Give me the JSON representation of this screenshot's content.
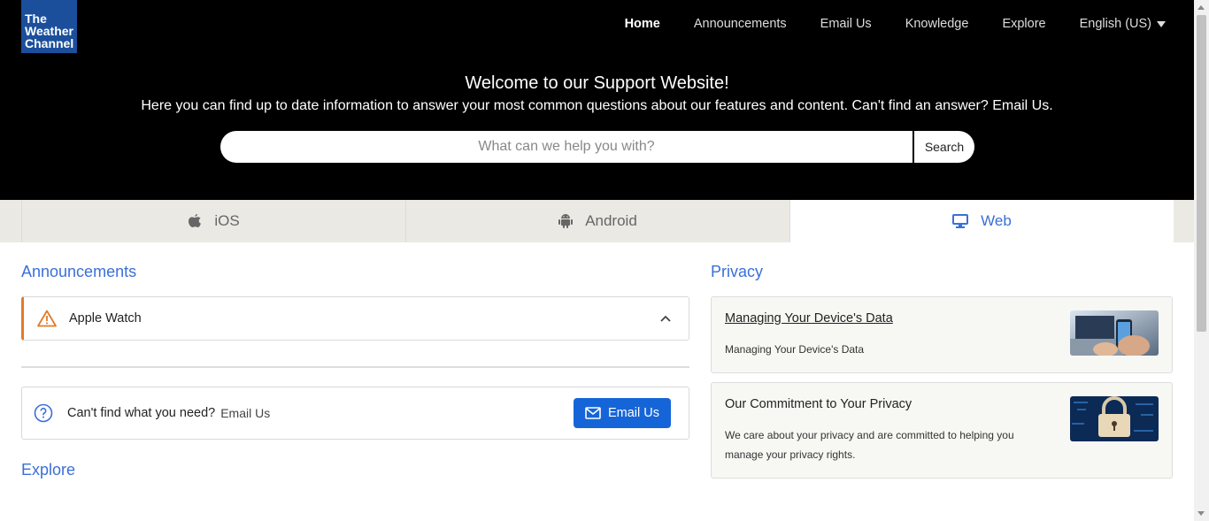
{
  "logo": {
    "line1": "The",
    "line2": "Weather",
    "line3": "Channel"
  },
  "nav": {
    "home": "Home",
    "announcements": "Announcements",
    "email": "Email Us",
    "knowledge": "Knowledge",
    "explore": "Explore",
    "language": "English (US)"
  },
  "hero": {
    "title": "Welcome to our Support Website!",
    "subtitle": "Here you can find up to date information to answer your most common questions about our features and content. Can't find an answer? Email Us.",
    "search_placeholder": "What can we help you with?",
    "search_button": "Search"
  },
  "tabs": [
    {
      "label": "iOS",
      "icon": "apple-icon"
    },
    {
      "label": "Android",
      "icon": "android-icon"
    },
    {
      "label": "Web",
      "icon": "monitor-icon",
      "active": true
    }
  ],
  "announcements": {
    "title": "Announcements",
    "items": [
      {
        "label": "Apple Watch",
        "icon": "warning-icon"
      }
    ]
  },
  "help": {
    "question": "Can't find what you need?",
    "link": "Email Us",
    "button": "Email Us"
  },
  "explore": {
    "title": "Explore"
  },
  "privacy": {
    "title": "Privacy",
    "cards": [
      {
        "title": "Managing Your Device's Data",
        "description": "Managing Your Device's Data"
      },
      {
        "title": "Our Commitment to Your Privacy",
        "description": "We care about your privacy and are committed to helping you manage your privacy rights."
      }
    ]
  },
  "colors": {
    "accent": "#3a6fd8",
    "button": "#1565d8",
    "warning": "#e07b2a",
    "brand": "#1b4f9c"
  }
}
